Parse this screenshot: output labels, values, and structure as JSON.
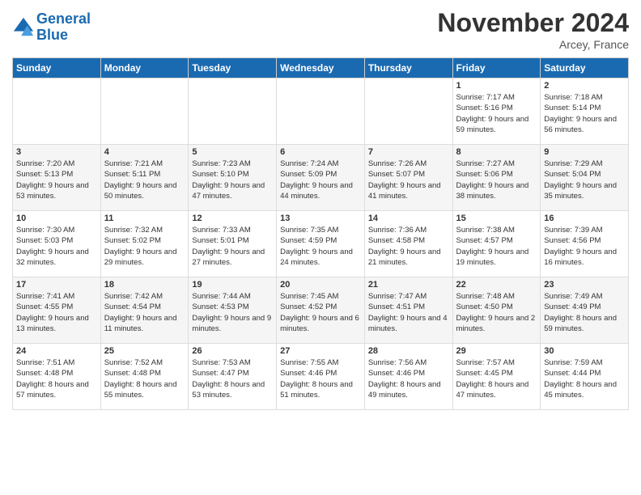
{
  "header": {
    "logo_line1": "General",
    "logo_line2": "Blue",
    "month": "November 2024",
    "location": "Arcey, France"
  },
  "weekdays": [
    "Sunday",
    "Monday",
    "Tuesday",
    "Wednesday",
    "Thursday",
    "Friday",
    "Saturday"
  ],
  "weeks": [
    [
      {
        "day": "",
        "info": ""
      },
      {
        "day": "",
        "info": ""
      },
      {
        "day": "",
        "info": ""
      },
      {
        "day": "",
        "info": ""
      },
      {
        "day": "",
        "info": ""
      },
      {
        "day": "1",
        "info": "Sunrise: 7:17 AM\nSunset: 5:16 PM\nDaylight: 9 hours and 59 minutes."
      },
      {
        "day": "2",
        "info": "Sunrise: 7:18 AM\nSunset: 5:14 PM\nDaylight: 9 hours and 56 minutes."
      }
    ],
    [
      {
        "day": "3",
        "info": "Sunrise: 7:20 AM\nSunset: 5:13 PM\nDaylight: 9 hours and 53 minutes."
      },
      {
        "day": "4",
        "info": "Sunrise: 7:21 AM\nSunset: 5:11 PM\nDaylight: 9 hours and 50 minutes."
      },
      {
        "day": "5",
        "info": "Sunrise: 7:23 AM\nSunset: 5:10 PM\nDaylight: 9 hours and 47 minutes."
      },
      {
        "day": "6",
        "info": "Sunrise: 7:24 AM\nSunset: 5:09 PM\nDaylight: 9 hours and 44 minutes."
      },
      {
        "day": "7",
        "info": "Sunrise: 7:26 AM\nSunset: 5:07 PM\nDaylight: 9 hours and 41 minutes."
      },
      {
        "day": "8",
        "info": "Sunrise: 7:27 AM\nSunset: 5:06 PM\nDaylight: 9 hours and 38 minutes."
      },
      {
        "day": "9",
        "info": "Sunrise: 7:29 AM\nSunset: 5:04 PM\nDaylight: 9 hours and 35 minutes."
      }
    ],
    [
      {
        "day": "10",
        "info": "Sunrise: 7:30 AM\nSunset: 5:03 PM\nDaylight: 9 hours and 32 minutes."
      },
      {
        "day": "11",
        "info": "Sunrise: 7:32 AM\nSunset: 5:02 PM\nDaylight: 9 hours and 29 minutes."
      },
      {
        "day": "12",
        "info": "Sunrise: 7:33 AM\nSunset: 5:01 PM\nDaylight: 9 hours and 27 minutes."
      },
      {
        "day": "13",
        "info": "Sunrise: 7:35 AM\nSunset: 4:59 PM\nDaylight: 9 hours and 24 minutes."
      },
      {
        "day": "14",
        "info": "Sunrise: 7:36 AM\nSunset: 4:58 PM\nDaylight: 9 hours and 21 minutes."
      },
      {
        "day": "15",
        "info": "Sunrise: 7:38 AM\nSunset: 4:57 PM\nDaylight: 9 hours and 19 minutes."
      },
      {
        "day": "16",
        "info": "Sunrise: 7:39 AM\nSunset: 4:56 PM\nDaylight: 9 hours and 16 minutes."
      }
    ],
    [
      {
        "day": "17",
        "info": "Sunrise: 7:41 AM\nSunset: 4:55 PM\nDaylight: 9 hours and 13 minutes."
      },
      {
        "day": "18",
        "info": "Sunrise: 7:42 AM\nSunset: 4:54 PM\nDaylight: 9 hours and 11 minutes."
      },
      {
        "day": "19",
        "info": "Sunrise: 7:44 AM\nSunset: 4:53 PM\nDaylight: 9 hours and 9 minutes."
      },
      {
        "day": "20",
        "info": "Sunrise: 7:45 AM\nSunset: 4:52 PM\nDaylight: 9 hours and 6 minutes."
      },
      {
        "day": "21",
        "info": "Sunrise: 7:47 AM\nSunset: 4:51 PM\nDaylight: 9 hours and 4 minutes."
      },
      {
        "day": "22",
        "info": "Sunrise: 7:48 AM\nSunset: 4:50 PM\nDaylight: 9 hours and 2 minutes."
      },
      {
        "day": "23",
        "info": "Sunrise: 7:49 AM\nSunset: 4:49 PM\nDaylight: 8 hours and 59 minutes."
      }
    ],
    [
      {
        "day": "24",
        "info": "Sunrise: 7:51 AM\nSunset: 4:48 PM\nDaylight: 8 hours and 57 minutes."
      },
      {
        "day": "25",
        "info": "Sunrise: 7:52 AM\nSunset: 4:48 PM\nDaylight: 8 hours and 55 minutes."
      },
      {
        "day": "26",
        "info": "Sunrise: 7:53 AM\nSunset: 4:47 PM\nDaylight: 8 hours and 53 minutes."
      },
      {
        "day": "27",
        "info": "Sunrise: 7:55 AM\nSunset: 4:46 PM\nDaylight: 8 hours and 51 minutes."
      },
      {
        "day": "28",
        "info": "Sunrise: 7:56 AM\nSunset: 4:46 PM\nDaylight: 8 hours and 49 minutes."
      },
      {
        "day": "29",
        "info": "Sunrise: 7:57 AM\nSunset: 4:45 PM\nDaylight: 8 hours and 47 minutes."
      },
      {
        "day": "30",
        "info": "Sunrise: 7:59 AM\nSunset: 4:44 PM\nDaylight: 8 hours and 45 minutes."
      }
    ]
  ]
}
